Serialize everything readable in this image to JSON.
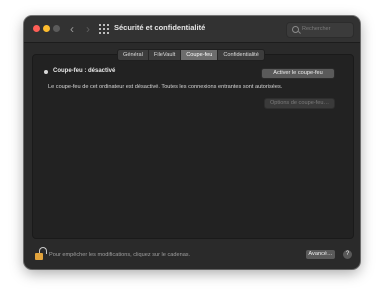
{
  "window": {
    "title": "Sécurité et confidentialité",
    "search_placeholder": "Rechercher"
  },
  "toolbar": {
    "back_icon": "chevron-left-icon",
    "forward_icon": "chevron-right-icon",
    "grid_icon": "grid-icon"
  },
  "tabs": [
    {
      "label": "Général",
      "active": false
    },
    {
      "label": "FileVault",
      "active": false
    },
    {
      "label": "Coupe-feu",
      "active": true
    },
    {
      "label": "Confidentialité",
      "active": false
    }
  ],
  "firewall": {
    "status_label": "Coupe-feu : désactivé",
    "activate_button": "Activer le coupe-feu",
    "description": "Le coupe-feu de cet ordinateur est désactivé. Toutes les connexions entrantes sont autorisées.",
    "options_button": "Options de coupe-feu…"
  },
  "footer": {
    "lock_text": "Pour empêcher les modifications, cliquez sur le cadenas.",
    "advanced_button": "Avancé…",
    "help_label": "?"
  },
  "colors": {
    "close": "#ff5f57",
    "minimize": "#febc2e",
    "lock": "#e2a33c"
  }
}
